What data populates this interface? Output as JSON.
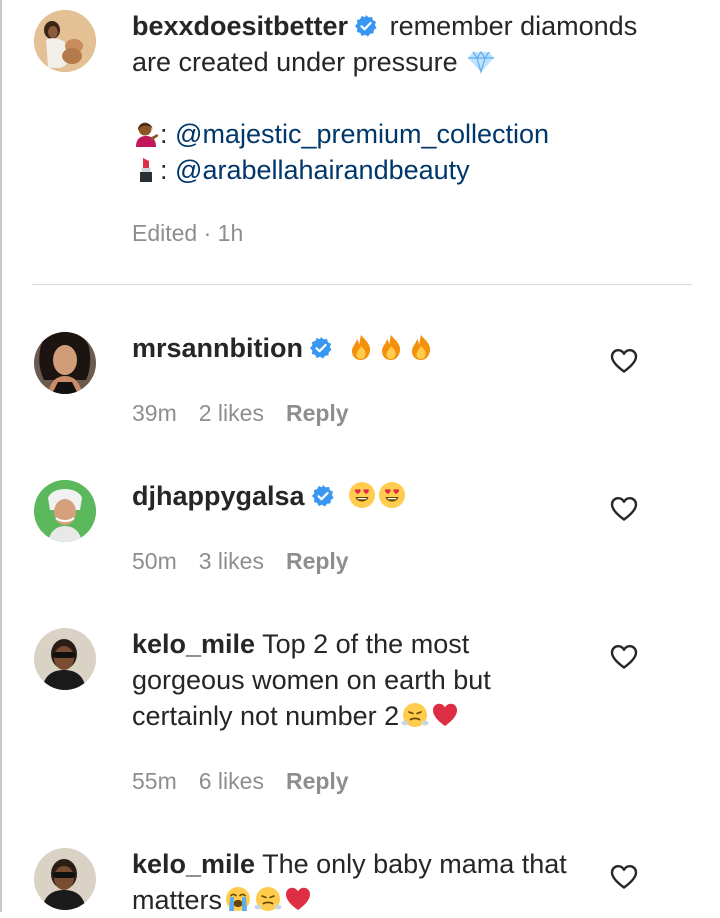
{
  "caption": {
    "username": "bexxdoesitbetter",
    "verified": true,
    "text_line1": "remember diamonds",
    "text_line2": "are created under pressure",
    "credit1_sep": ":",
    "credit1_mention": "@majestic_premium_collection",
    "credit2_sep": ":",
    "credit2_mention": "@arabellahairandbeauty",
    "meta": "Edited · 1h",
    "emoji_names": [
      "gem-stone",
      "woman-tipping-hand-medium-dark",
      "lipstick"
    ]
  },
  "comments": [
    {
      "username": "mrsannbition",
      "verified": true,
      "emoji_names": [
        "fire",
        "fire",
        "fire"
      ],
      "time": "39m",
      "likes": "2 likes",
      "reply": "Reply"
    },
    {
      "username": "djhappygalsa",
      "verified": true,
      "emoji_names": [
        "smiling-face-heart-eyes",
        "smiling-face-heart-eyes"
      ],
      "time": "50m",
      "likes": "3 likes",
      "reply": "Reply"
    },
    {
      "username": "kelo_mile",
      "verified": false,
      "text_line1": "Top 2 of the most",
      "text_line2": "gorgeous women on earth but",
      "text_line3": "certainly not number 2",
      "emoji_names": [
        "face-with-steam-from-nose",
        "red-heart"
      ],
      "time": "55m",
      "likes": "6 likes",
      "reply": "Reply"
    },
    {
      "username": "kelo_mile",
      "verified": false,
      "text_line1": "The only baby mama that",
      "text_line2": "matters",
      "emoji_names": [
        "loudly-crying-face",
        "face-with-steam-from-nose",
        "red-heart"
      ]
    }
  ],
  "colors": {
    "text": "#262626",
    "secondary": "#8e8e8e",
    "mention": "#00376b",
    "verified_badge": "#3897f0",
    "divider": "#dbdbdb"
  }
}
